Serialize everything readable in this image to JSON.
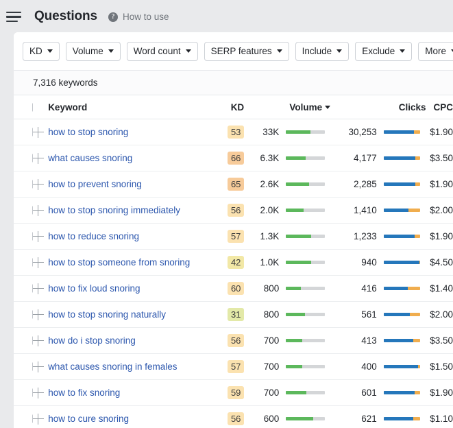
{
  "header": {
    "menu_icon": "hamburger-icon",
    "title": "Questions",
    "help_icon_glyph": "?",
    "howto_label": "How to use"
  },
  "filters": [
    {
      "label": "KD"
    },
    {
      "label": "Volume"
    },
    {
      "label": "Word count"
    },
    {
      "label": "SERP features"
    },
    {
      "label": "Include"
    },
    {
      "label": "Exclude"
    },
    {
      "label": "More"
    }
  ],
  "results": {
    "count_label": "7,316 keywords"
  },
  "table": {
    "columns": {
      "keyword": "Keyword",
      "kd": "KD",
      "volume": "Volume",
      "clicks": "Clicks",
      "cpc": "CPC"
    },
    "rows": [
      {
        "keyword": "how to stop snoring",
        "kd": "53",
        "kd_color": "#fbe2b0",
        "volume": "33K",
        "volume_pct": 62,
        "clicks": "30,253",
        "clicks_blue_pct": 83,
        "cpc": "$1.90"
      },
      {
        "keyword": "what causes snoring",
        "kd": "66",
        "kd_color": "#f7cb9a",
        "volume": "6.3K",
        "volume_pct": 50,
        "clicks": "4,177",
        "clicks_blue_pct": 86,
        "cpc": "$3.50"
      },
      {
        "keyword": "how to prevent snoring",
        "kd": "65",
        "kd_color": "#f7cb9a",
        "volume": "2.6K",
        "volume_pct": 60,
        "clicks": "2,285",
        "clicks_blue_pct": 86,
        "cpc": "$1.90"
      },
      {
        "keyword": "how to stop snoring immediately",
        "kd": "56",
        "kd_color": "#fbe2b0",
        "volume": "2.0K",
        "volume_pct": 45,
        "clicks": "1,410",
        "clicks_blue_pct": 67,
        "cpc": "$2.00"
      },
      {
        "keyword": "how to reduce snoring",
        "kd": "57",
        "kd_color": "#fbe2b0",
        "volume": "1.3K",
        "volume_pct": 65,
        "clicks": "1,233",
        "clicks_blue_pct": 85,
        "cpc": "$1.90"
      },
      {
        "keyword": "how to stop someone from snoring",
        "kd": "42",
        "kd_color": "#f2e8a6",
        "volume": "1.0K",
        "volume_pct": 64,
        "clicks": "940",
        "clicks_blue_pct": 97,
        "cpc": "$4.50"
      },
      {
        "keyword": "how to fix loud snoring",
        "kd": "60",
        "kd_color": "#fbe2b0",
        "volume": "800",
        "volume_pct": 38,
        "clicks": "416",
        "clicks_blue_pct": 65,
        "cpc": "$1.40"
      },
      {
        "keyword": "how to stop snoring naturally",
        "kd": "31",
        "kd_color": "#e3e9a8",
        "volume": "800",
        "volume_pct": 48,
        "clicks": "561",
        "clicks_blue_pct": 72,
        "cpc": "$2.00"
      },
      {
        "keyword": "how do i stop snoring",
        "kd": "56",
        "kd_color": "#fbe2b0",
        "volume": "700",
        "volume_pct": 42,
        "clicks": "413",
        "clicks_blue_pct": 80,
        "cpc": "$3.50"
      },
      {
        "keyword": "what causes snoring in females",
        "kd": "57",
        "kd_color": "#fbe2b0",
        "volume": "700",
        "volume_pct": 42,
        "clicks": "400",
        "clicks_blue_pct": 94,
        "cpc": "$1.50"
      },
      {
        "keyword": "how to fix snoring",
        "kd": "59",
        "kd_color": "#fbe2b0",
        "volume": "700",
        "volume_pct": 53,
        "clicks": "601",
        "clicks_blue_pct": 84,
        "cpc": "$1.90"
      },
      {
        "keyword": "how to cure snoring",
        "kd": "56",
        "kd_color": "#fbe2b0",
        "volume": "600",
        "volume_pct": 70,
        "clicks": "621",
        "clicks_blue_pct": 80,
        "cpc": "$1.10"
      }
    ]
  },
  "colors": {
    "volume_bar": "#5cb85c",
    "volume_track": "#d4d6d8",
    "clicks_bar": "#2577bb",
    "clicks_rest": "#f0ad4e",
    "link": "#2b56ad",
    "avatar": "#4dbd93"
  }
}
